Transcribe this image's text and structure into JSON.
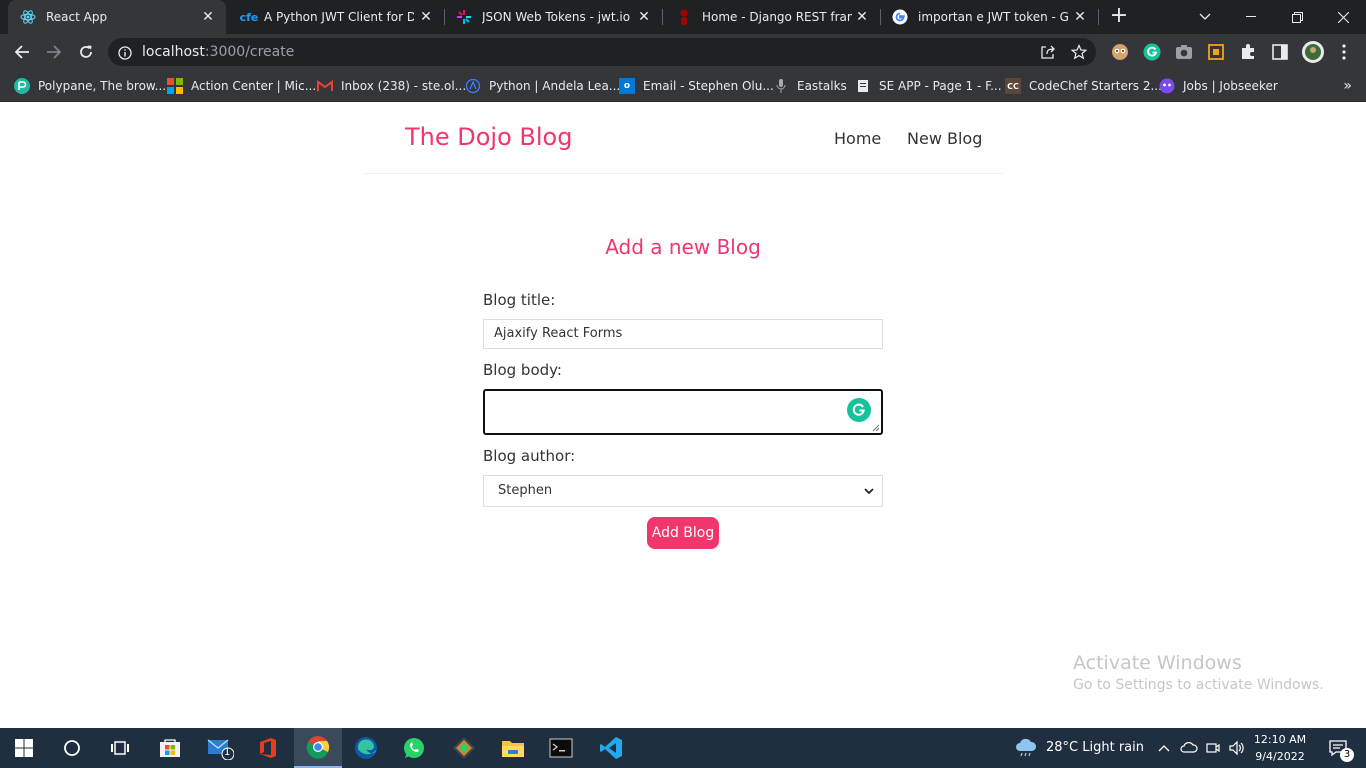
{
  "browser": {
    "tabs": [
      {
        "title": "React App",
        "active": true,
        "icon": "react-icon"
      },
      {
        "title": "A Python JWT Client for Djan",
        "active": false,
        "icon": "cfe-icon"
      },
      {
        "title": "JSON Web Tokens - jwt.io",
        "active": false,
        "icon": "jwt-icon"
      },
      {
        "title": "Home - Django REST framew",
        "active": false,
        "icon": "django-rest-icon"
      },
      {
        "title": "importan e JWT token - Goo",
        "active": false,
        "icon": "google-icon"
      }
    ],
    "url": {
      "host": "localhost",
      "path": ":3000/create"
    },
    "bookmarks": [
      "Polypane, The brow...",
      "Action Center | Mic...",
      "Inbox (238) - ste.ol...",
      "Python | Andela Lea...",
      "Email - Stephen Olu...",
      "Eastalks",
      "SE APP - Page 1 - F...",
      "CodeChef Starters 2...",
      "Jobs | Jobseeker"
    ]
  },
  "app": {
    "brand": "The Dojo Blog",
    "nav": {
      "home": "Home",
      "new_blog": "New Blog"
    },
    "create": {
      "heading": "Add a new Blog",
      "title_label": "Blog title:",
      "title_value": "Ajaxify React Forms",
      "body_label": "Blog body:",
      "body_value": "",
      "author_label": "Blog author:",
      "author_value": "Stephen",
      "submit_label": "Add Blog"
    }
  },
  "watermark": {
    "line1": "Activate Windows",
    "line2": "Go to Settings to activate Windows."
  },
  "taskbar": {
    "weather": "28°C  Light rain",
    "time": "12:10 AM",
    "date": "9/4/2022",
    "mail_badge": "1",
    "notification_count": "3"
  },
  "colors": {
    "accent": "#f1356d",
    "chrome_dark": "#202124",
    "chrome_toolbar": "#35363a",
    "taskbar": "#1f2f3f"
  }
}
